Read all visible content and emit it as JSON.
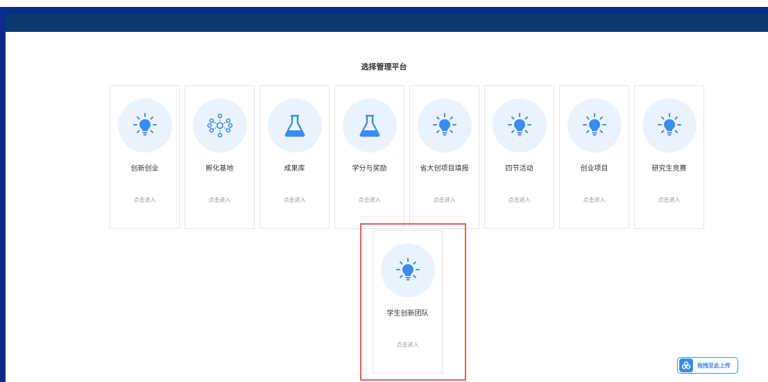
{
  "page": {
    "title": "选择管理平台"
  },
  "colors": {
    "topbar": "#0a3a6e",
    "frame": "#0b2c8c",
    "icon": "#3b8cf0",
    "circle": "#eaf3fd",
    "highlight": "#e35b5b"
  },
  "cards": [
    {
      "name": "创新创业",
      "enter": "点击进入",
      "icon": "lightbulb-icon"
    },
    {
      "name": "孵化基地",
      "enter": "点击进入",
      "icon": "network-icon"
    },
    {
      "name": "成果库",
      "enter": "点击进入",
      "icon": "flask-icon"
    },
    {
      "name": "学分与奖励",
      "enter": "点击进入",
      "icon": "flask-icon"
    },
    {
      "name": "省大创项目填报",
      "enter": "点击进入",
      "icon": "lightbulb-icon"
    },
    {
      "name": "四节活动",
      "enter": "点击进入",
      "icon": "lightbulb-icon"
    },
    {
      "name": "创业项目",
      "enter": "点击进入",
      "icon": "lightbulb-icon"
    },
    {
      "name": "研究生竞赛",
      "enter": "点击进入",
      "icon": "lightbulb-icon"
    },
    {
      "name": "学生创新团队",
      "enter": "点击进入",
      "icon": "lightbulb-icon"
    }
  ],
  "upload": {
    "label": "拖拽至此上传",
    "icon": "cloud-share-icon"
  }
}
